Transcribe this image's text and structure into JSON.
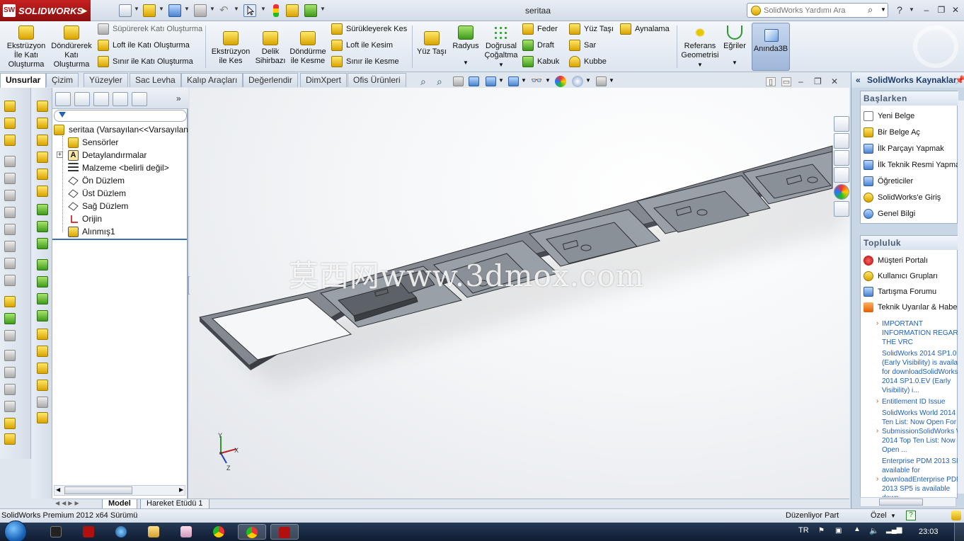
{
  "app": {
    "brand": "SOLIDWORKS",
    "document_title": "seritaa",
    "help_search_placeholder": "SolidWorks Yardımı Ara",
    "colors": {
      "brand_red": "#b01010",
      "tree_accent": "#3d6fb5",
      "link_blue": "#1f5fb5"
    }
  },
  "ribbon": {
    "large_buttons": [
      {
        "id": "extrude",
        "label_lines": [
          "Ekstrüzyon",
          "İle Katı",
          "Oluşturma"
        ]
      },
      {
        "id": "revolve",
        "label_lines": [
          "Döndürerek",
          "Katı",
          "Oluşturma"
        ]
      },
      {
        "id": "extrude-cut",
        "label_lines": [
          "Ekstrüzyon",
          "ile Kes"
        ]
      },
      {
        "id": "hole-wizard",
        "label_lines": [
          "Delik",
          "Sihirbazı"
        ]
      },
      {
        "id": "revolve-cut",
        "label_lines": [
          "Döndürme",
          "ile Kesme"
        ]
      },
      {
        "id": "face-move",
        "label_lines": [
          "Yüz Taşı"
        ]
      },
      {
        "id": "fillet",
        "label_lines": [
          "Radyus"
        ]
      },
      {
        "id": "linear-pattern",
        "label_lines": [
          "Doğrusal",
          "Çoğaltma"
        ]
      },
      {
        "id": "ref-geometry",
        "label_lines": [
          "Referans",
          "Geometrisi"
        ]
      },
      {
        "id": "curves",
        "label_lines": [
          "Eğriler"
        ]
      },
      {
        "id": "instant3d",
        "label_lines": [
          "Anında3B"
        ]
      }
    ],
    "small_buttons": {
      "sweep": "Süpürerek Katı Oluşturma",
      "loft": "Loft ile Katı Oluşturma",
      "boundary": "Sınır ile Katı Oluşturma",
      "swept_cut": "Sürükleyerek Kes",
      "lofted_cut": "Loft ile Kesim",
      "boundary_cut": "Sınır ile Kesme",
      "rib": "Feder",
      "draft": "Draft",
      "shell": "Kabuk",
      "face_move2": "Yüz Taşı",
      "wrap": "Sar",
      "dome": "Kubbe",
      "mirror": "Aynalama"
    }
  },
  "tabs": [
    "Unsurlar",
    "Çizim",
    "Yüzeyler",
    "Sac Levha",
    "Kalıp Araçları",
    "Değerlendir",
    "DimXpert",
    "Ofis Ürünleri"
  ],
  "feature_tree": {
    "root": "seritaa  (Varsayılan<<Varsayılan",
    "items": [
      {
        "label": "Sensörler",
        "icon": "sensor-icon"
      },
      {
        "label": "Detaylandırmalar",
        "icon": "annotations-icon"
      },
      {
        "label": "Malzeme <belirli değil>",
        "icon": "material-icon"
      },
      {
        "label": "Ön Düzlem",
        "icon": "plane-icon"
      },
      {
        "label": "Üst Düzlem",
        "icon": "plane-icon"
      },
      {
        "label": "Sağ Düzlem",
        "icon": "plane-icon"
      },
      {
        "label": "Orijin",
        "icon": "origin-icon"
      },
      {
        "label": "Alınmış1",
        "icon": "imported-icon"
      }
    ]
  },
  "model_tabs": [
    "Model",
    "Hareket Etüdü 1"
  ],
  "graphics": {
    "watermark": "莫西网www.3dmox.com",
    "triad_labels": {
      "x": "X",
      "y": "Y",
      "z": "Z"
    }
  },
  "taskpane": {
    "title": "SolidWorks Kaynaklar",
    "getting_started": {
      "title": "Başlarken",
      "items": [
        "Yeni Belge",
        "Bir Belge Aç",
        "İlk Parçayı Yapmak",
        "İlk Teknik Resmi Yapmak",
        "Öğreticiler",
        "SolidWorks'e Giriş",
        "Genel Bilgi"
      ]
    },
    "community": {
      "title": "Topluluk",
      "items": [
        "Müşteri Portalı",
        "Kullanıcı Grupları",
        "Tartışma Forumu",
        "Teknik Uyarılar & Haberler"
      ]
    },
    "news": [
      {
        "arrow": true,
        "lines": [
          "IMPORTANT",
          "INFORMATION REGARDING",
          "THE VRC"
        ]
      },
      {
        "arrow": false,
        "lines": [
          "SolidWorks 2014 SP1.0",
          "(Early Visibility) is available",
          "for downloadSolidWorks",
          "2014 SP1.0.EV (Early",
          "Visibility) i..."
        ]
      },
      {
        "arrow": true,
        "lines": [
          "Entitlement ID Issue"
        ]
      },
      {
        "arrow": false,
        "lines": [
          "SolidWorks World 2014 Top",
          "Ten List: Now Open For"
        ]
      },
      {
        "arrow": true,
        "lines": [
          "SubmissionSolidWorks World",
          "2014 Top Ten List: Now",
          "Open ..."
        ]
      },
      {
        "arrow": false,
        "lines": [
          "Enterprise PDM 2013 SP5",
          "available for"
        ]
      },
      {
        "arrow": true,
        "lines": [
          "downloadEnterprise PDM",
          "2013 SP5 is available",
          "down..."
        ]
      }
    ]
  },
  "status": {
    "left": "SolidWorks Premium 2012 x64 Sürümü",
    "mode": "Düzenliyor Part",
    "units": "Özel",
    "help_mark": "?"
  },
  "taskbar": {
    "language": "TR",
    "time": "23:03"
  }
}
